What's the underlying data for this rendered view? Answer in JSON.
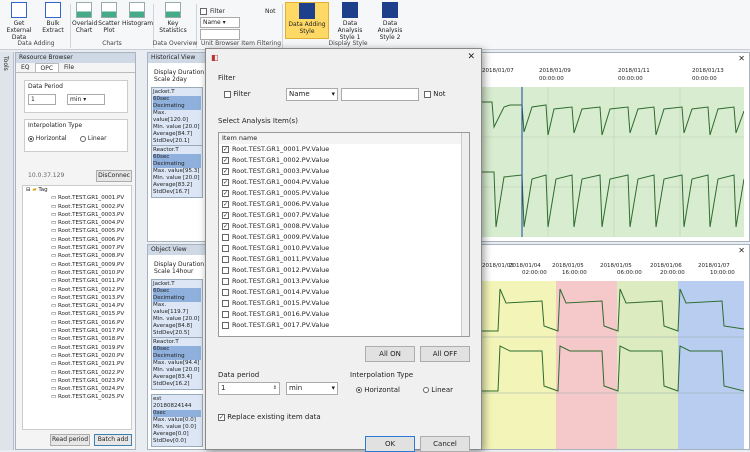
{
  "ribbon": {
    "buttons": [
      {
        "label": "Get External Data",
        "icon": "external-data-icon"
      },
      {
        "label": "Bulk Extract",
        "icon": "bulk-extract-icon"
      },
      {
        "label": "Overlaid Chart",
        "icon": "overlaid-chart-icon"
      },
      {
        "label": "Scatter Plot",
        "icon": "scatter-plot-icon"
      },
      {
        "label": "Histogram",
        "icon": "histogram-icon"
      },
      {
        "label": "Key Statistics",
        "icon": "key-statistics-icon"
      },
      {
        "label": "Data Adding Style",
        "icon": "data-adding-style-icon"
      },
      {
        "label": "Data Analysis Style 1",
        "icon": "data-analysis-style1-icon"
      },
      {
        "label": "Data Analysis Style 2",
        "icon": "data-analysis-style2-icon"
      }
    ],
    "groups": [
      "Data Adding",
      "Charts",
      "Data Overview",
      "Unit Browser Item Filtering",
      "Display Style"
    ],
    "filter_label": "Filter",
    "filter_select": "Name",
    "not_label": "Not"
  },
  "resource_browser": {
    "title": "Resource Browser",
    "tabs": [
      "EQ",
      "OPC",
      "File"
    ],
    "data_period_label": "Data Period",
    "data_period_value": "1",
    "data_period_unit": "min",
    "interp_label": "Interpolation Type",
    "interp_options": [
      "Horizontal",
      "Linear"
    ],
    "server": "10.0.37.129",
    "disconnect_label": "DisConnec",
    "tree_root": "Tag",
    "tags": [
      "Root.TEST.GR1_0001.PV",
      "Root.TEST.GR1_0002.PV",
      "Root.TEST.GR1_0003.PV",
      "Root.TEST.GR1_0004.PV",
      "Root.TEST.GR1_0005.PV",
      "Root.TEST.GR1_0006.PV",
      "Root.TEST.GR1_0007.PV",
      "Root.TEST.GR1_0008.PV",
      "Root.TEST.GR1_0009.PV",
      "Root.TEST.GR1_0010.PV",
      "Root.TEST.GR1_0011.PV",
      "Root.TEST.GR1_0012.PV",
      "Root.TEST.GR1_0013.PV",
      "Root.TEST.GR1_0014.PV",
      "Root.TEST.GR1_0015.PV",
      "Root.TEST.GR1_0016.PV",
      "Root.TEST.GR1_0017.PV",
      "Root.TEST.GR1_0018.PV",
      "Root.TEST.GR1_0019.PV",
      "Root.TEST.GR1_0020.PV",
      "Root.TEST.GR1_0021.PV",
      "Root.TEST.GR1_0022.PV",
      "Root.TEST.GR1_0023.PV",
      "Root.TEST.GR1_0024.PV",
      "Root.TEST.GR1_0025.PV"
    ],
    "read_period_label": "Read period",
    "batch_add_label": "Batch add",
    "side_tab": "Tools"
  },
  "historical_view": {
    "title": "Historical View",
    "duration": "Display Duration",
    "scale": "Scale 2day",
    "stats": [
      {
        "name": "Jacket.T",
        "lines": [
          "60sec Decimating",
          "Max. value[120.0]",
          "Min. value [20.0]",
          "Average[84.7]",
          "StdDev[20.1]"
        ]
      },
      {
        "name": "Reactor.T",
        "lines": [
          "60sec Decimating",
          "Max. value[95.3]",
          "Min. value [20.0]",
          "Average[83.2]",
          "StdDev[16.7]"
        ]
      }
    ],
    "dates": [
      "2018/01/07",
      "2018/01/09",
      "2018/01/11",
      "2018/01/13"
    ],
    "times": [
      "00:00:00",
      "00:00:00",
      "00:00:00",
      "00:00:00"
    ]
  },
  "object_view": {
    "title": "Object View",
    "duration": "Display Duration",
    "scale": "Scale 14hour",
    "stats": [
      {
        "name": "Jacket.T",
        "lines": [
          "60sec Decimating",
          "Max. value[119.7]",
          "Min. value [20.0]",
          "Average[84.8]",
          "StdDev[20.5]"
        ]
      },
      {
        "name": "Reactor.T",
        "lines": [
          "60sec Decimating",
          "Max. value[94.4]",
          "Min. value [20.0]",
          "Average[83.4]",
          "StdDev[16.2]"
        ]
      },
      {
        "name": "est 20180824144",
        "lines": [
          "0sec",
          "Max. value[0.0]",
          "Min. value [0.0]",
          "Average[0.0]",
          "StdDev[0.0]"
        ]
      }
    ],
    "dates": [
      "2018/01/03",
      "2018/01/04",
      "2018/01/05",
      "2018/01/05",
      "2018/01/06",
      "2018/01/07"
    ],
    "times": [
      "",
      "02:00:00",
      "16:00:00",
      "06:00:00",
      "20:00:00",
      "10:00:00"
    ]
  },
  "dialog": {
    "filter_group": "Filter",
    "filter_check": "Filter",
    "filter_field": "Name",
    "filter_text": "",
    "not_label": "Not",
    "select_label": "Select Analysis Item(s)",
    "list_header": "Item name",
    "items": [
      {
        "name": "Root.TEST.GR1_0001.PV.Value",
        "checked": true
      },
      {
        "name": "Root.TEST.GR1_0002.PV.Value",
        "checked": true
      },
      {
        "name": "Root.TEST.GR1_0003.PV.Value",
        "checked": true
      },
      {
        "name": "Root.TEST.GR1_0004.PV.Value",
        "checked": true
      },
      {
        "name": "Root.TEST.GR1_0005.PV.Value",
        "checked": true
      },
      {
        "name": "Root.TEST.GR1_0006.PV.Value",
        "checked": true
      },
      {
        "name": "Root.TEST.GR1_0007.PV.Value",
        "checked": true
      },
      {
        "name": "Root.TEST.GR1_0008.PV.Value",
        "checked": true
      },
      {
        "name": "Root.TEST.GR1_0009.PV.Value",
        "checked": false
      },
      {
        "name": "Root.TEST.GR1_0010.PV.Value",
        "checked": false
      },
      {
        "name": "Root.TEST.GR1_0011.PV.Value",
        "checked": false
      },
      {
        "name": "Root.TEST.GR1_0012.PV.Value",
        "checked": false
      },
      {
        "name": "Root.TEST.GR1_0013.PV.Value",
        "checked": false
      },
      {
        "name": "Root.TEST.GR1_0014.PV.Value",
        "checked": false
      },
      {
        "name": "Root.TEST.GR1_0015.PV.Value",
        "checked": false
      },
      {
        "name": "Root.TEST.GR1_0016.PV.Value",
        "checked": false
      },
      {
        "name": "Root.TEST.GR1_0017.PV.Value",
        "checked": false
      }
    ],
    "all_on": "All ON",
    "all_off": "All OFF",
    "data_period_label": "Data period",
    "data_period_value": "1",
    "data_period_unit": "min",
    "interp_label": "Interpolation Type",
    "interp_options": [
      "Horizontal",
      "Linear"
    ],
    "replace_label": "Replace existing item data",
    "ok": "OK",
    "cancel": "Cancel"
  }
}
